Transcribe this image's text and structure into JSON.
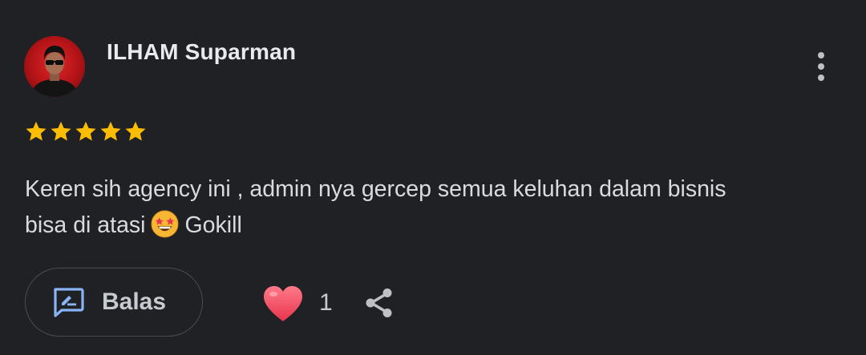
{
  "review": {
    "author": "ILHAM Suparman",
    "rating": 5,
    "rating_max": 5,
    "text_line1": "Keren sih agency ini , admin nya gercep semua keluhan dalam bisnis",
    "text_line2_start": "bisa di atasi",
    "text_emoji": "star-struck-emoji",
    "text_line2_end": "Gokill",
    "reply_label": "Balas",
    "like_count": "1"
  },
  "icons": {
    "more": "more-vertical-icon",
    "reply": "reply-icon",
    "like": "heart-icon",
    "share": "share-icon",
    "star": "star-icon"
  },
  "colors": {
    "background": "#202124",
    "star": "#fbbc04",
    "heart": "#f2546b",
    "reply_icon": "#8ab4f8",
    "text": "#d9dbde"
  }
}
